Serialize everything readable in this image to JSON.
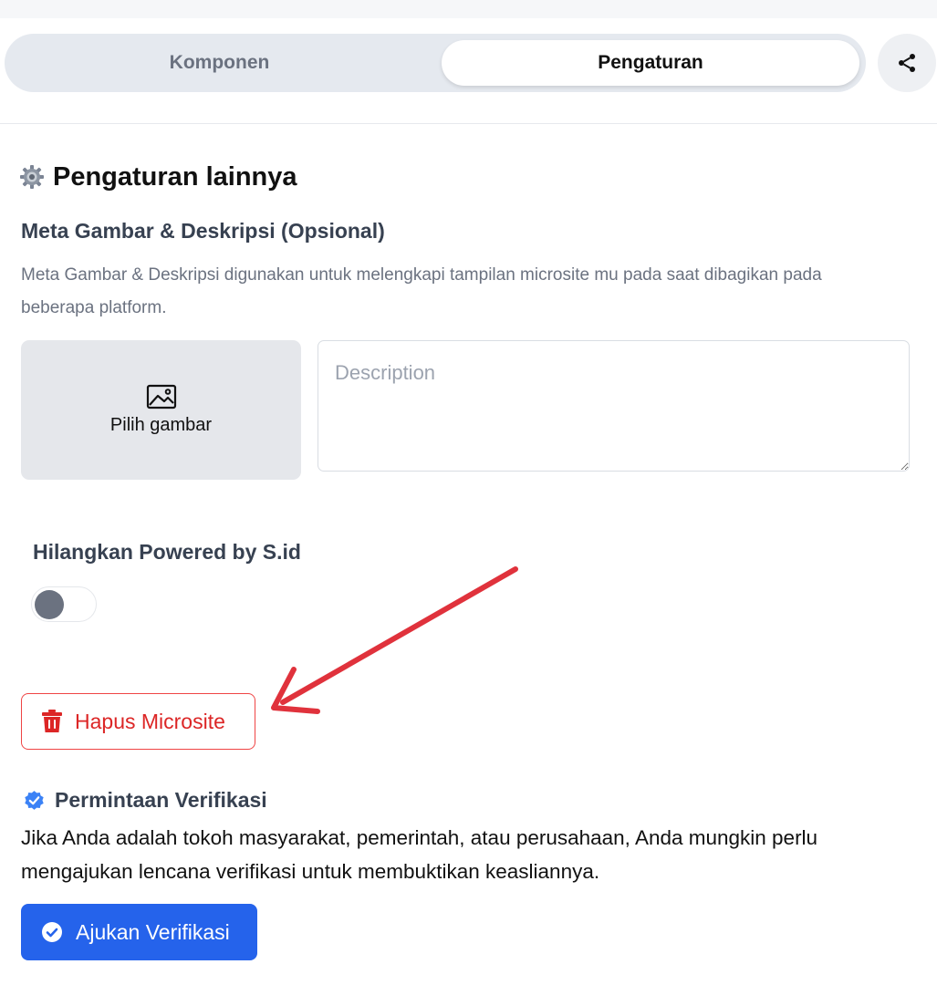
{
  "tabs": [
    {
      "label": "Komponen",
      "active": false
    },
    {
      "label": "Pengaturan",
      "active": true
    }
  ],
  "share": {
    "icon": "share-icon"
  },
  "settings": {
    "title": "Pengaturan lainnya",
    "title_icon": "gear-icon"
  },
  "meta": {
    "title": "Meta Gambar & Deskripsi (Opsional)",
    "description": "Meta Gambar & Deskripsi digunakan untuk melengkapi tampilan microsite mu pada saat dibagikan pada beberapa platform.",
    "image_picker_label": "Pilih gambar",
    "image_picker_icon": "image-icon",
    "description_placeholder": "Description",
    "description_value": ""
  },
  "powered": {
    "title": "Hilangkan Powered by S.id",
    "toggle_on": false
  },
  "delete": {
    "label": "Hapus Microsite",
    "icon": "trash-icon"
  },
  "verification": {
    "title": "Permintaan Verifikasi",
    "title_icon": "verified-badge-icon",
    "description": "Jika Anda adalah tokoh masyarakat, pemerintah, atau perusahaan, Anda mungkin perlu mengajukan lencana verifikasi untuk membuktikan keasliannya.",
    "button_label": "Ajukan Verifikasi",
    "button_icon": "check-circle-icon"
  },
  "colors": {
    "primary": "#2563eb",
    "danger": "#dc2626",
    "annotation_arrow": "#e0323c",
    "tab_track": "#e5e9ef"
  }
}
